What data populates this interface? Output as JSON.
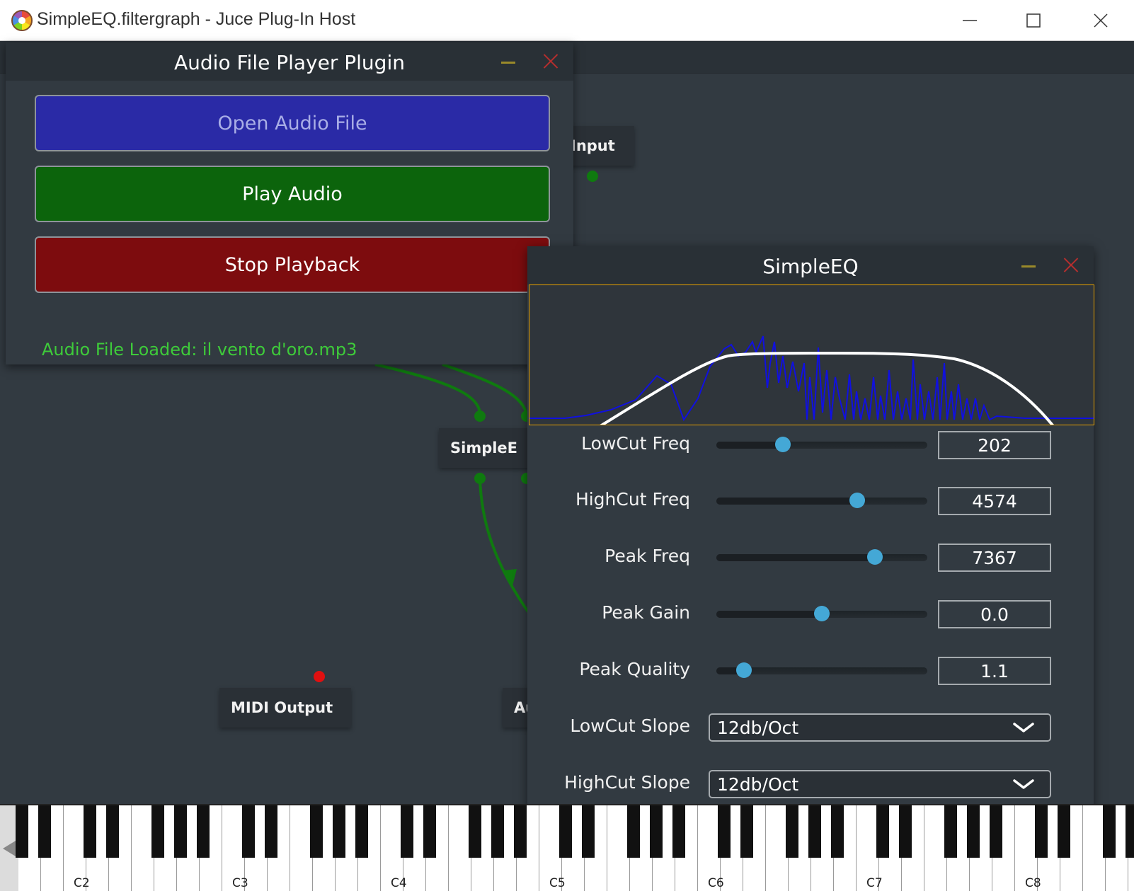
{
  "window": {
    "title": "SimpleEQ.filtergraph - Juce Plug-In Host"
  },
  "graph_nodes": {
    "input": "Input",
    "simpleeq": "SimpleE",
    "midi_output": "MIDI Output",
    "audio_output": "Au"
  },
  "audio_player": {
    "title": "Audio File Player Plugin",
    "open_label": "Open Audio File",
    "play_label": "Play Audio",
    "stop_label": "Stop Playback",
    "loaded_text": "Audio File Loaded:  il vento d'oro.mp3"
  },
  "simple_eq": {
    "title": "SimpleEQ",
    "sliders": [
      {
        "label": "LowCut Freq",
        "value": "202",
        "position": 0.3
      },
      {
        "label": "HighCut Freq",
        "value": "4574",
        "position": 0.68
      },
      {
        "label": "Peak Freq",
        "value": "7367",
        "position": 0.77
      },
      {
        "label": "Peak Gain",
        "value": "0.0",
        "position": 0.5
      },
      {
        "label": "Peak Quality",
        "value": "1.1",
        "position": 0.1
      }
    ],
    "combos": [
      {
        "label": "LowCut Slope",
        "value": "12db/Oct"
      },
      {
        "label": "HighCut Slope",
        "value": "12db/Oct"
      }
    ]
  },
  "keyboard": {
    "octave_labels": [
      "C2",
      "C3",
      "C4",
      "C5",
      "C6",
      "C7",
      "C8"
    ]
  },
  "colors": {
    "open_button": "#2a2aa6",
    "play_button": "#0c640c",
    "stop_button": "#7d0c0e",
    "loaded_text": "#3ecb3a",
    "slider_thumb": "#44a8d6",
    "spectrum": "#1010e0",
    "response_curve": "#ffffff",
    "graph_border": "#e8a200",
    "connection": "#0f7a0f",
    "midi_pin": "#e01010"
  }
}
